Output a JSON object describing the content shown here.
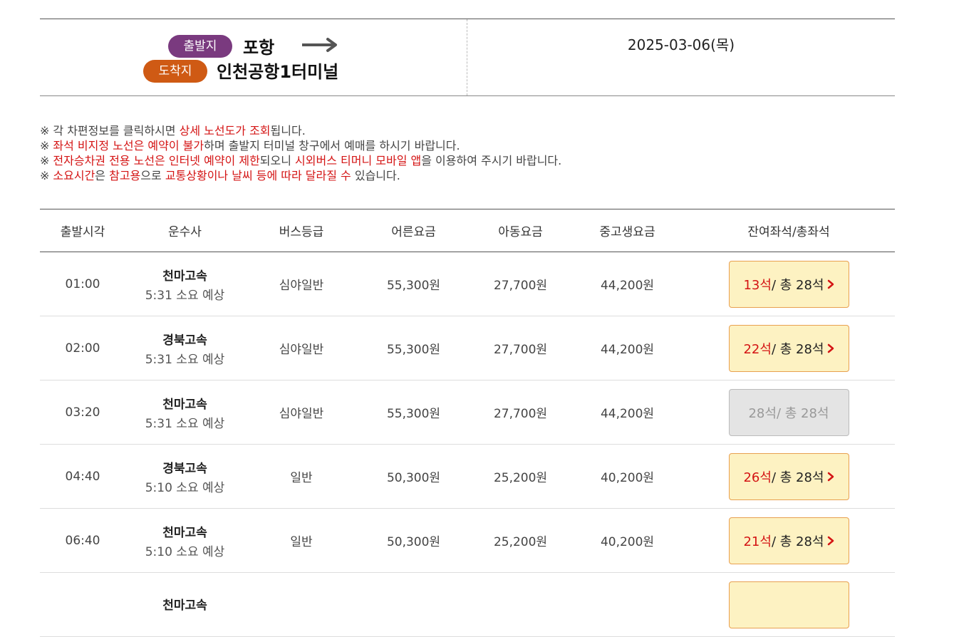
{
  "route": {
    "departure_label": "출발지",
    "departure_city": "포항",
    "arrival_label": "도착지",
    "arrival_city": "인천공항1터미널",
    "date": "2025-03-06(목)"
  },
  "notices": [
    {
      "mark": "※",
      "parts": [
        {
          "text": "각 차편정보를 클릭하시면 ",
          "hl": false
        },
        {
          "text": "상세 노선도가 조회",
          "hl": true
        },
        {
          "text": "됩니다.",
          "hl": false
        }
      ]
    },
    {
      "mark": "※",
      "parts": [
        {
          "text": "좌석 비지정 노선은 예약이 불가",
          "hl": true
        },
        {
          "text": "하며 출발지 터미널 창구에서 예매를 하시기 바랍니다.",
          "hl": false
        }
      ]
    },
    {
      "mark": "※",
      "parts": [
        {
          "text": "전자승차권 전용 노선은 인터넷 예약이 제한",
          "hl": true
        },
        {
          "text": "되오니 ",
          "hl": false
        },
        {
          "text": "시외버스 티머니 모바일 앱",
          "hl": true
        },
        {
          "text": "을 이용하여 주시기 바랍니다.",
          "hl": false
        }
      ]
    },
    {
      "mark": "※",
      "parts": [
        {
          "text": "소요시간",
          "hl": true
        },
        {
          "text": "은 ",
          "hl": false
        },
        {
          "text": "참고용",
          "hl": true
        },
        {
          "text": "으로 ",
          "hl": false
        },
        {
          "text": "교통상황이나 날씨 등에 따라 달라질 수",
          "hl": true
        },
        {
          "text": " 있습니다.",
          "hl": false
        }
      ]
    }
  ],
  "table": {
    "headers": [
      "출발시각",
      "운수사",
      "버스등급",
      "어른요금",
      "아동요금",
      "중고생요금",
      "잔여좌석/총좌석"
    ],
    "rows": [
      {
        "time": "01:00",
        "company": "천마고속",
        "duration": "5:31 소요 예상",
        "grade": "심야일반",
        "adult": "55,300원",
        "child": "27,700원",
        "youth": "44,200원",
        "remaining": "13석",
        "total": " / 총 28석",
        "available": true
      },
      {
        "time": "02:00",
        "company": "경북고속",
        "duration": "5:31 소요 예상",
        "grade": "심야일반",
        "adult": "55,300원",
        "child": "27,700원",
        "youth": "44,200원",
        "remaining": "22석",
        "total": " / 총 28석",
        "available": true
      },
      {
        "time": "03:20",
        "company": "천마고속",
        "duration": "5:31 소요 예상",
        "grade": "심야일반",
        "adult": "55,300원",
        "child": "27,700원",
        "youth": "44,200원",
        "remaining": "28석",
        "total": " / 총 28석",
        "available": false
      },
      {
        "time": "04:40",
        "company": "경북고속",
        "duration": "5:10 소요 예상",
        "grade": "일반",
        "adult": "50,300원",
        "child": "25,200원",
        "youth": "40,200원",
        "remaining": "26석",
        "total": " / 총 28석",
        "available": true
      },
      {
        "time": "06:40",
        "company": "천마고속",
        "duration": "5:10 소요 예상",
        "grade": "일반",
        "adult": "50,300원",
        "child": "25,200원",
        "youth": "40,200원",
        "remaining": "21석",
        "total": " / 총 28석",
        "available": true
      },
      {
        "time": "",
        "company": "천마고속",
        "duration": "",
        "grade": "",
        "adult": "",
        "child": "",
        "youth": "",
        "remaining": "",
        "total": "",
        "available": true
      }
    ]
  },
  "colors": {
    "departure_pill": "#7a3a7f",
    "arrival_pill": "#cf5a14",
    "highlight": "#d41414",
    "seat_button_bg": "#fdf2c2",
    "seat_button_border": "#e8a050"
  },
  "icons": {
    "route_arrow": "arrow-right-icon",
    "seat_chevron": "chevron-right-icon"
  }
}
